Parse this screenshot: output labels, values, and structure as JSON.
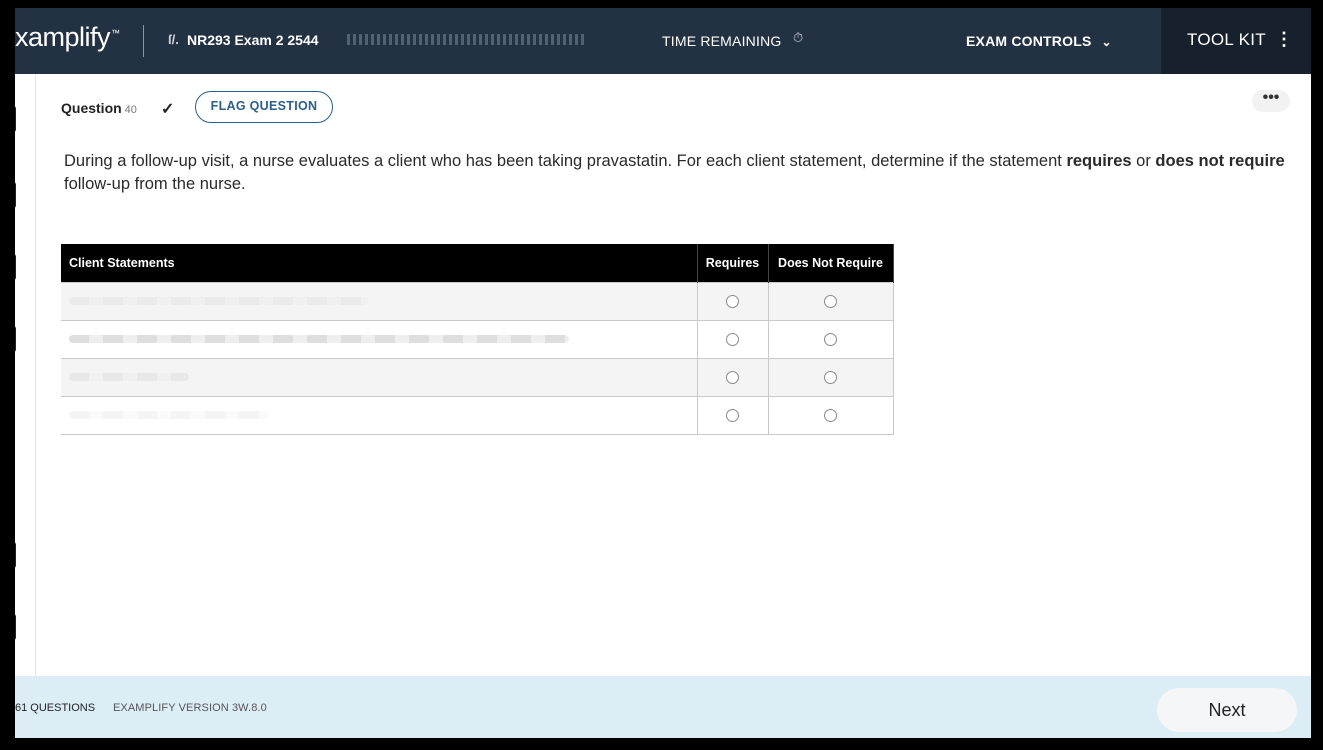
{
  "header": {
    "logo_text": "xamplify",
    "logo_tm": "™",
    "exam_icon": "ſ/.",
    "exam_title": "NR293 Exam 2 2544",
    "time_label": "TIME REMAINING",
    "time_icon": "stopwatch-icon",
    "exam_controls_label": "EXAM CONTROLS",
    "tool_kit_label": "TOOL KIT"
  },
  "question": {
    "label": "Question",
    "number": "40",
    "flag_label": "FLAG QUESTION",
    "more_label": "•••",
    "stem_part1": "During a follow-up visit, a nurse evaluates a client who has been taking pravastatin. For each client statement, determine if the statement ",
    "stem_bold1": "requires",
    "stem_part2": " or ",
    "stem_bold2": "does not require",
    "stem_part3": " follow-up from the nurse."
  },
  "grid": {
    "headers": [
      "Client Statements",
      "Requires",
      "Does Not Require"
    ],
    "rows": [
      {
        "statement": "",
        "requires": false,
        "does_not_require": false
      },
      {
        "statement": "",
        "requires": false,
        "does_not_require": false
      },
      {
        "statement": "",
        "requires": false,
        "does_not_require": false
      },
      {
        "statement": "",
        "requires": false,
        "does_not_require": false
      }
    ]
  },
  "footer": {
    "question_count": "61 QUESTIONS",
    "version": "EXAMPLIFY VERSION 3W.8.0",
    "next_label": "Next"
  },
  "colors": {
    "header_bg": "#233243",
    "toolkit_bg": "#17212d",
    "accent": "#2c5f8a",
    "footer_bg": "#dcedf6"
  }
}
